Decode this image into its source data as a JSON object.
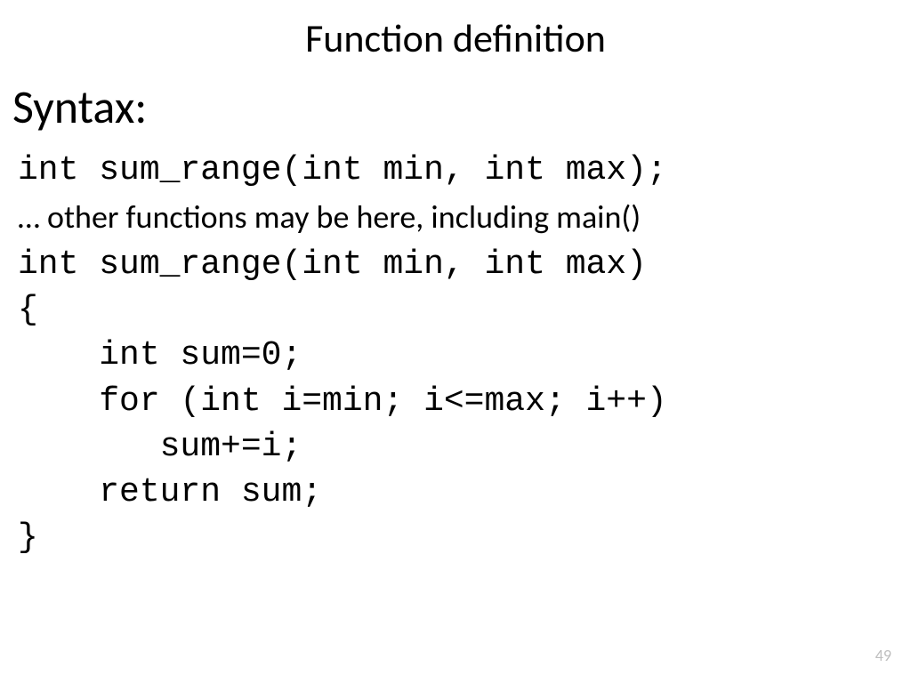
{
  "title": "Function definition",
  "subtitle": "Syntax:",
  "lines": {
    "l1": "int sum_range(int min, int max);",
    "l2": "… other functions may be here, including main()",
    "l3": "int sum_range(int min, int max)",
    "l4": "{",
    "l5": "    int sum=0;",
    "l6": "    for (int i=min; i<=max; i++)",
    "l7": "       sum+=i;",
    "l8": "    return sum;",
    "l9": "}"
  },
  "page_number": "49"
}
